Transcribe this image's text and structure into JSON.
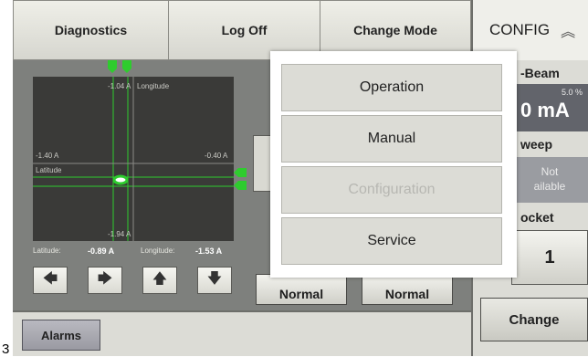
{
  "edge_label": "3",
  "topbar": {
    "diagnostics": "Diagnostics",
    "log_off": "Log Off",
    "change_mode": "Change Mode"
  },
  "config": {
    "title": "CONFIG",
    "chevron_icon": "chevron-up-double-icon",
    "beam_label": "-Beam",
    "beam_percent": "5.0 %",
    "beam_value": "0 mA",
    "sweep_label": "weep",
    "sweep_status_line1": "Not",
    "sweep_status_line2": "ailable",
    "pocket_label": "ocket",
    "pocket_value": "1",
    "change_label": "Change"
  },
  "plot": {
    "top_value": "-1.04 A",
    "top_axis": "Longitude",
    "left_value": "-1.40 A",
    "left_axis": "Latitude",
    "right_value": "-0.40 A",
    "bottom_value": "-1.94 A"
  },
  "readout": {
    "latitude_label": "Latitude:",
    "latitude_value": "-0.89 A",
    "longitude_label": "Longitude:",
    "longitude_value": "-1.53 A"
  },
  "arrows": [
    "arrow-left-icon",
    "arrow-right-icon",
    "arrow-up-icon",
    "arrow-down-icon"
  ],
  "normal_buttons": [
    "Normal",
    "Normal"
  ],
  "bottom": {
    "alarms": "Alarms"
  },
  "mode_menu": {
    "items": [
      {
        "label": "Operation",
        "enabled": true
      },
      {
        "label": "Manual",
        "enabled": true
      },
      {
        "label": "Configuration",
        "enabled": false
      },
      {
        "label": "Service",
        "enabled": true
      }
    ]
  },
  "colors": {
    "background": "#7e807d",
    "plot_bg": "#3a3a38",
    "green_marker": "#2ecc2e",
    "beam_box": "#62646b"
  }
}
